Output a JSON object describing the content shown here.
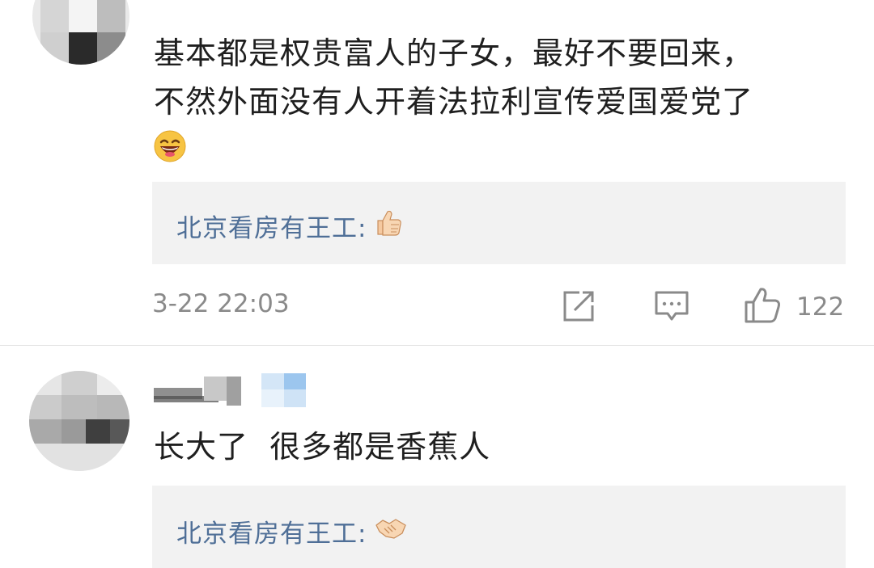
{
  "comments": [
    {
      "text_lines": [
        "基本都是权贵富人的子女，最好不要回来，",
        "不然外面没有人开着法拉利宣传爱国爱党了"
      ],
      "emoji": "laughing-face",
      "reply": {
        "author": "北京看房有王工:",
        "emoji": "thumbs-up"
      },
      "timestamp": "3-22 22:03",
      "likes": "122"
    },
    {
      "text_lines": [
        "长大了  很多都是香蕉人"
      ],
      "reply": {
        "author": "北京看房有王工:",
        "emoji": "handshake"
      }
    }
  ],
  "colors": {
    "reply_author": "#4f6f97",
    "meta_text": "#8a8a8a",
    "reply_bg": "#f2f2f2",
    "comment_text": "#1f1f1f"
  }
}
